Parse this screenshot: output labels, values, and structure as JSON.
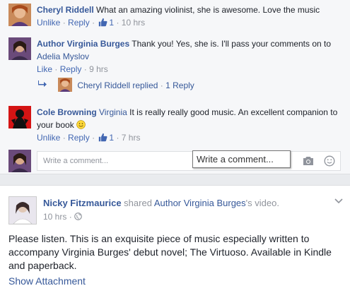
{
  "comments": [
    {
      "author": "Cheryl Riddell",
      "text": "What an amazing violinist, she is awesome. Love the music",
      "actions": {
        "unlike": "Unlike",
        "reply": "Reply",
        "likes": "1",
        "time": "10 hrs"
      }
    },
    {
      "author": "Author Virginia Burges",
      "text": "Thank you! Yes, she is. I'll pass your comments on to",
      "mention": "Adelia Myslov",
      "actions": {
        "like": "Like",
        "reply": "Reply",
        "time": "9 hrs"
      }
    },
    {
      "author": "Cole Browning",
      "mention": "Virginia",
      "text": "It is really really good music. An excellent companion to your book",
      "actions": {
        "unlike": "Unlike",
        "reply": "Reply",
        "likes": "1",
        "time": "7 hrs"
      }
    }
  ],
  "replies_summary": {
    "author": "Cheryl Riddell",
    "verb": "replied",
    "count_label": "1 Reply"
  },
  "composer": {
    "placeholder": "Write a comment...",
    "tooltip": "Write a comment..."
  },
  "post": {
    "author": "Nicky Fitzmaurice",
    "action": "shared",
    "target": "Author Virginia Burges",
    "suffix": "'s video.",
    "time": "10 hrs",
    "body": "Please listen. This is an exquisite piece of music especially written to accompany Virginia Burges' debut novel; The Virtuoso. Available in Kindle and paperback.",
    "show_attachment": "Show Attachment"
  },
  "icons": {
    "like": "thumbs-up-icon",
    "reply_arrow": "reply-arrow-icon",
    "emoji": "smiley-emoji-icon",
    "camera": "camera-icon",
    "emoticon": "emoticon-icon",
    "globe": "globe-icon",
    "chevron": "chevron-down-icon"
  },
  "colors": {
    "link": "#365899",
    "meta": "#90949c",
    "text": "#1d2129"
  }
}
